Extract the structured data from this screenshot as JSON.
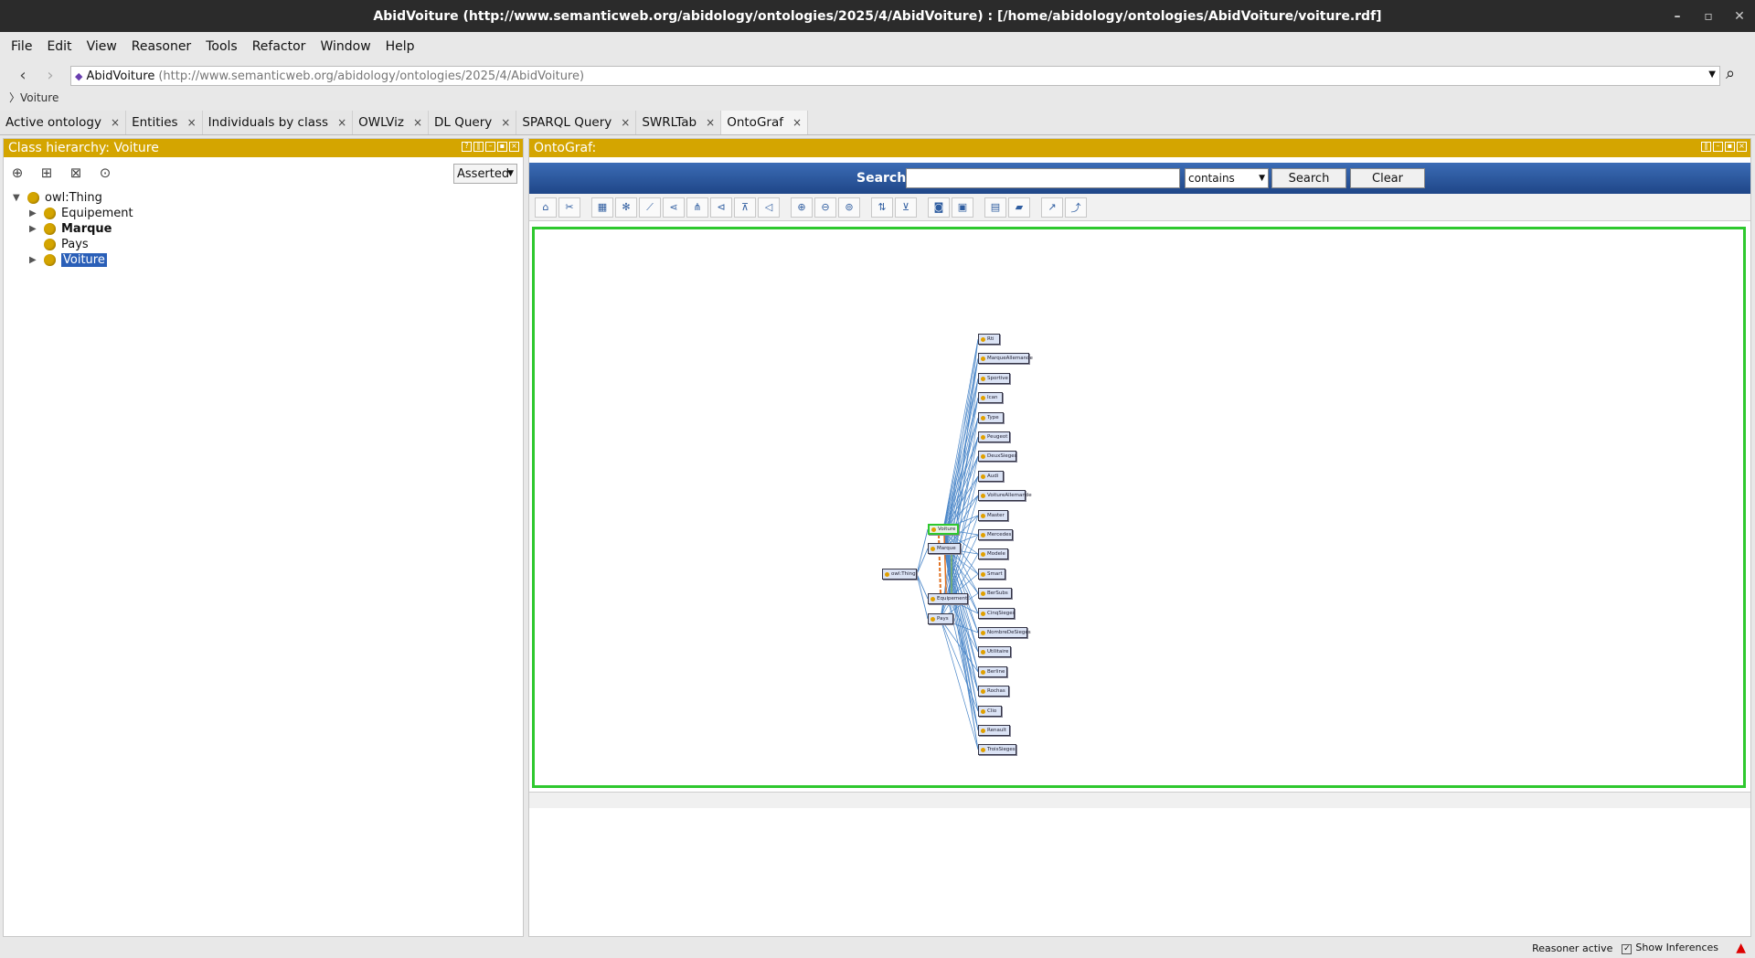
{
  "window": {
    "title": "AbidVoiture (http://www.semanticweb.org/abidology/ontologies/2025/4/AbidVoiture) : [/home/abidology/ontologies/AbidVoiture/voiture.rdf]"
  },
  "menu": [
    "File",
    "Edit",
    "View",
    "Reasoner",
    "Tools",
    "Refactor",
    "Window",
    "Help"
  ],
  "address": {
    "name": "AbidVoiture",
    "iri": "(http://www.semanticweb.org/abidology/ontologies/2025/4/AbidVoiture)"
  },
  "breadcrumb": "Voiture",
  "tabs": [
    "Active ontology",
    "Entities",
    "Individuals by class",
    "OWLViz",
    "DL Query",
    "SPARQL Query",
    "SWRLTab",
    "OntoGraf"
  ],
  "left_panel": {
    "title": "Class hierarchy: Voiture",
    "mode": "Asserted",
    "tree": [
      {
        "label": "owl:Thing",
        "level": 0
      },
      {
        "label": "Equipement",
        "level": 1
      },
      {
        "label": "Marque",
        "level": 1
      },
      {
        "label": "Pays",
        "level": 1
      },
      {
        "label": "Voiture",
        "level": 1
      }
    ]
  },
  "ontograf": {
    "title": "OntoGraf:",
    "search_label": "Search:",
    "search_value": "",
    "match_mode": "contains",
    "search_button": "Search",
    "clear_button": "Clear",
    "nodes_left": [
      "owl:Thing",
      "Voiture",
      "Marque",
      "Equipement",
      "Pays"
    ],
    "nodes_right": [
      "Rti",
      "MarqueAllemande",
      "Sportive",
      "Ican",
      "Type",
      "Peugeot",
      "DeuxSieges",
      "Audi",
      "VoitureAllemande",
      "Master",
      "Mercedes",
      "Modele",
      "Smart",
      "BerSubs",
      "CinqSieges",
      "NombreDeSieges",
      "Utilitaire",
      "Berline",
      "Rochas",
      "Clio",
      "Renault",
      "TroisSieges"
    ]
  },
  "status": {
    "reasoner": "Reasoner active",
    "show_inferences": "Show Inferences"
  }
}
